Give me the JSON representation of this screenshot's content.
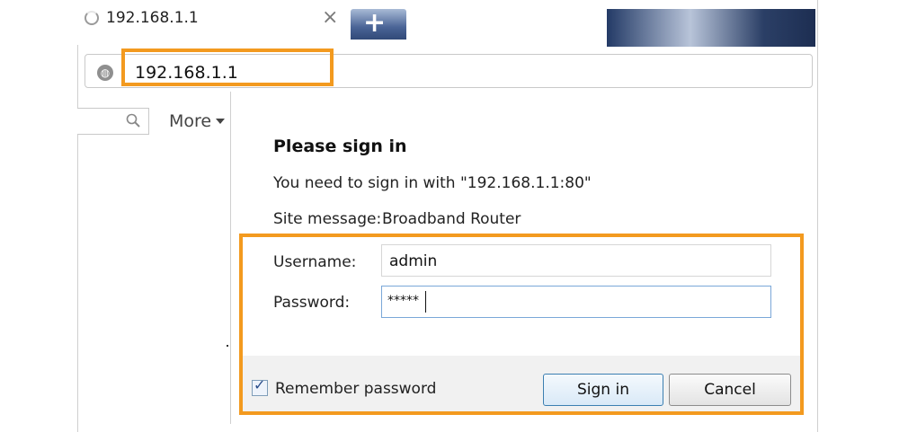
{
  "browser": {
    "tab": {
      "title": "192.168.1.1",
      "close_glyph": "×"
    },
    "new_tab_glyph": "+",
    "address": {
      "url": "192.168.1.1"
    },
    "toolbar": {
      "more_label": "More"
    }
  },
  "dialog": {
    "title": "Please sign in",
    "message": "You need to sign in with \"192.168.1.1:80\"",
    "site_message_label": "Site message:",
    "site_message_value": "Broadband Router",
    "username_label": "Username:",
    "username_value": "admin",
    "password_label": "Password:",
    "password_value": "*****",
    "remember_label": "Remember password",
    "remember_checked": true,
    "signin_label": "Sign in",
    "cancel_label": "Cancel"
  },
  "colors": {
    "highlight": "#f39a1f",
    "focus_border": "#7aa7d8"
  }
}
